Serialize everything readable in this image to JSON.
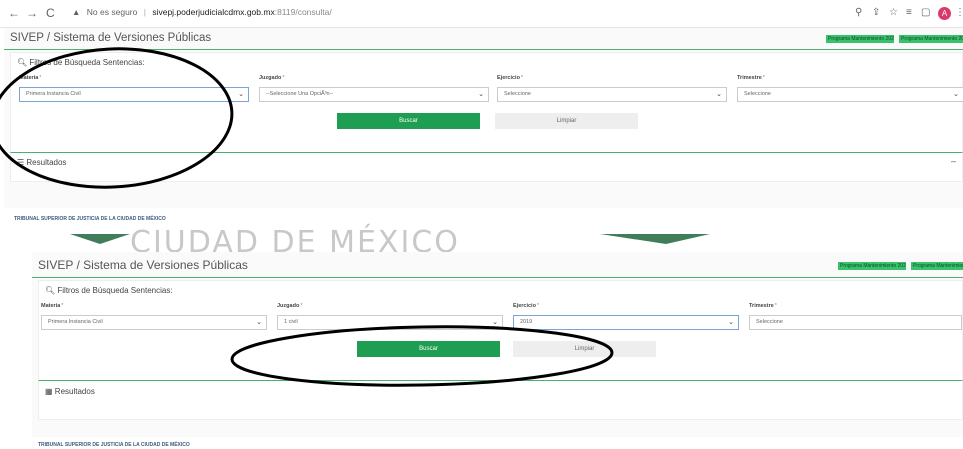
{
  "browser": {
    "back": "←",
    "forward": "→",
    "reload": "C",
    "security_warning": "No es seguro",
    "url_host": "sivepj.poderjudicialcdmx.gob.mx",
    "url_path": ":8119/consulta/",
    "profile_initial": "A"
  },
  "top": {
    "app_title": "SIVEP / Sistema de Versiones Públicas",
    "program_links": [
      "Programa Mantenimiento 2021",
      "Programa Mantenimiento 2022"
    ],
    "filters_title": "Filtros de Búsqueda Sentencias:",
    "fields": [
      {
        "label": "Materia",
        "value": "Primera Instancia Civil"
      },
      {
        "label": "Juzgado",
        "value": "--Seleccione Una OpciÃ³n--"
      },
      {
        "label": "Ejercicio",
        "value": "Seleccione"
      },
      {
        "label": "Trimestre",
        "value": "Seleccione"
      }
    ],
    "search_button": "Buscar",
    "clear_button": "Limpiar",
    "results_title": "Resultados",
    "collapse_symbol": "–",
    "footer": "TRIBUNAL SUPERIOR DE JUSTICIA DE LA CIUDAD DE MÉXICO"
  },
  "bottom": {
    "watermark_text": "CIUDAD DE MÉXICO",
    "app_title": "SIVEP / Sistema de Versiones Públicas",
    "program_links": [
      "Programa Mantenimiento 2021",
      "Programa Mantenimiento"
    ],
    "filters_title": "Filtros de Búsqueda Sentencias:",
    "fields": [
      {
        "label": "Materia",
        "value": "Primera Instancia Civil"
      },
      {
        "label": "Juzgado",
        "value": "1 civil"
      },
      {
        "label": "Ejercicio",
        "value": "2019"
      },
      {
        "label": "Trimestre",
        "value": "Seleccione"
      }
    ],
    "search_button": "Buscar",
    "clear_button": "Limpiar",
    "results_title": "Resultados",
    "footer": "TRIBUNAL SUPERIOR DE JUSTICIA DE LA CIUDAD DE MÉXICO"
  },
  "colors": {
    "accent_green": "#1e9e52",
    "header_line": "#4caf6d",
    "annotation": "#000000"
  }
}
